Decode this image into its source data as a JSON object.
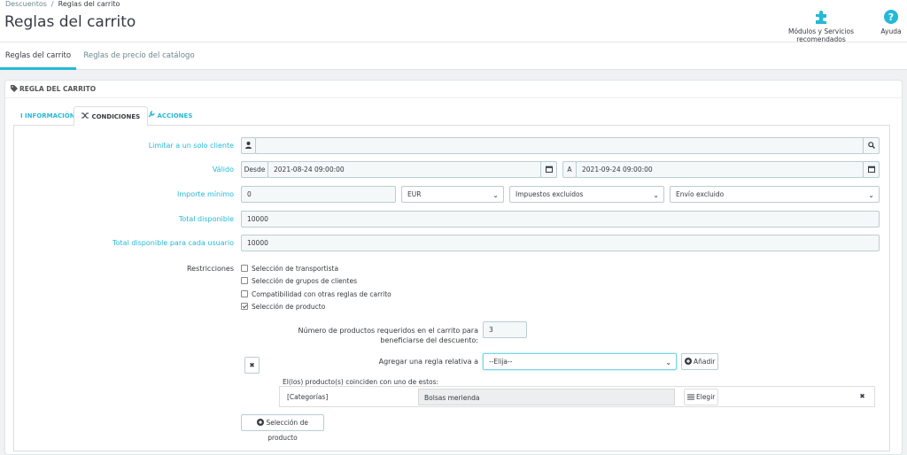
{
  "header": {
    "breadcrumb": [
      "Descuentos",
      "Reglas del carrito"
    ],
    "breadcrumb_sep": "/",
    "title": "Reglas del carrito",
    "modules_label": "Módulos y Servicios recomendados",
    "help_label": "Ayuda"
  },
  "tabs": [
    "Reglas del carrito",
    "Reglas de precio del catálogo"
  ],
  "panel": {
    "heading": "Regla del carrito",
    "subtabs": [
      "Información",
      "Condiciones",
      "Acciones"
    ]
  },
  "form": {
    "client_label": "Limitar a un solo cliente",
    "client_value": "",
    "valid_label": "Válido",
    "from_label": "Desde",
    "from_value": "2021-08-24 09:00:00",
    "to_label": "A",
    "to_value": "2021-09-24 09:00:00",
    "min_label": "Importe mínimo",
    "min_value": "0",
    "currency": "EUR",
    "taxes": "Impuestos excluidos",
    "shipping": "Envío excluido",
    "total_label": "Total disponible",
    "total_value": "10000",
    "per_user_label": "Total disponible para cada usuario",
    "per_user_value": "10000",
    "restrictions_label": "Restricciones",
    "restrictions": [
      {
        "label": "Selección de transportista",
        "checked": false
      },
      {
        "label": "Selección de grupos de clientes",
        "checked": false
      },
      {
        "label": "Compatibilidad con otras reglas de carrito",
        "checked": false
      },
      {
        "label": "Selección de producto",
        "checked": true
      }
    ],
    "qty_label_1": "Número de productos requeridos en el carrito para",
    "qty_label_2": "beneficiarse del descuento:",
    "qty_value": "3",
    "rule_label": "Agregar una regla relativa a",
    "rule_select": "--Elija--",
    "add_button": "Añadir",
    "products_match": "El(los) producto(s) coinciden con uno de estos:",
    "row_type": "[Categorías]",
    "row_value": "Bolsas merienda",
    "choose_button": "Elegir",
    "product_selection_button": "Selección de producto"
  },
  "colors": {
    "accent": "#25b9d7",
    "text": "#363a41"
  }
}
